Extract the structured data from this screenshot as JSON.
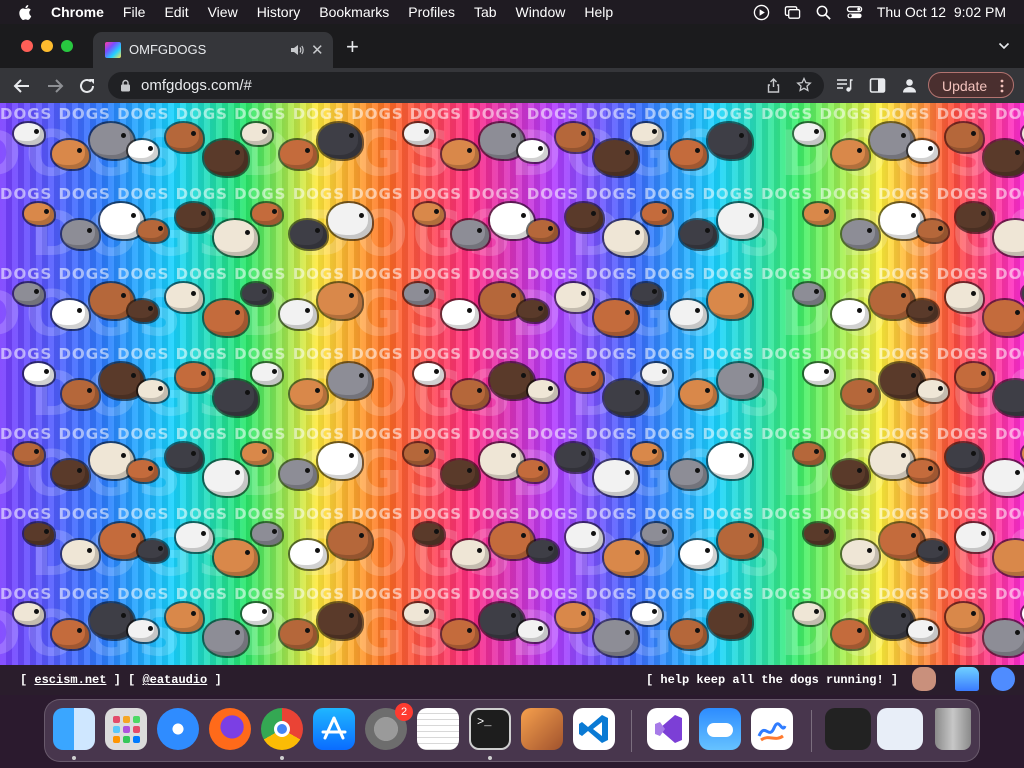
{
  "menubar": {
    "app_name": "Chrome",
    "items": [
      "File",
      "Edit",
      "View",
      "History",
      "Bookmarks",
      "Profiles",
      "Tab",
      "Window",
      "Help"
    ],
    "clock": "Thu Oct 12  9:02 PM"
  },
  "tab": {
    "title": "OMFGDOGS",
    "close_label": "✕"
  },
  "toolbar": {
    "url": "omfgdogs.com/#",
    "update_label": "Update"
  },
  "page": {
    "background_word": "DOGS",
    "footer_links": [
      "escism.net",
      "@eataudio"
    ],
    "footer_message": "[ help keep all the dogs running! ]"
  },
  "dock": {
    "apps": [
      "finder",
      "launchpad",
      "safari",
      "firefox",
      "chrome",
      "app-store",
      "system-settings",
      "textedit",
      "terminal",
      "garageband",
      "vscode",
      "visual-studio",
      "weather",
      "freeform",
      "screenshot-thumbnail-1",
      "screenshot-thumbnail-2",
      "trash"
    ],
    "settings_badge": "2"
  },
  "colors": {
    "accent": "#ff2a82",
    "update_border": "#b27370"
  }
}
